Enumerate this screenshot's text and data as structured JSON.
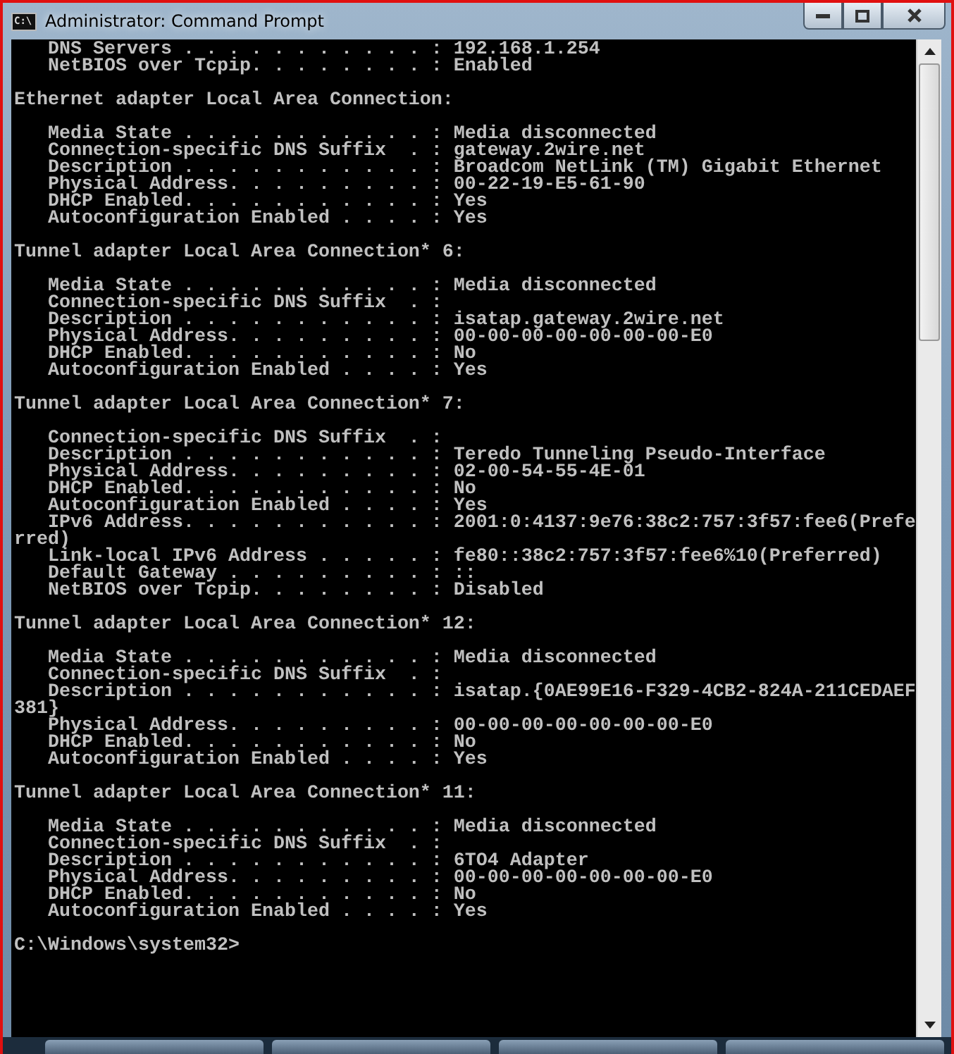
{
  "window": {
    "title": "Administrator: Command Prompt",
    "icon_text": "C:\\"
  },
  "console": {
    "blocks": [
      {
        "lines": [
          "   DNS Servers . . . . . . . . . . . : 192.168.1.254",
          "   NetBIOS over Tcpip. . . . . . . . : Enabled"
        ]
      },
      {
        "lines": [
          "Ethernet adapter Local Area Connection:"
        ]
      },
      {
        "lines": [
          "   Media State . . . . . . . . . . . : Media disconnected",
          "   Connection-specific DNS Suffix  . : gateway.2wire.net",
          "   Description . . . . . . . . . . . : Broadcom NetLink (TM) Gigabit Ethernet",
          "   Physical Address. . . . . . . . . : 00-22-19-E5-61-90",
          "   DHCP Enabled. . . . . . . . . . . : Yes",
          "   Autoconfiguration Enabled . . . . : Yes"
        ]
      },
      {
        "lines": [
          "Tunnel adapter Local Area Connection* 6:"
        ]
      },
      {
        "lines": [
          "   Media State . . . . . . . . . . . : Media disconnected",
          "   Connection-specific DNS Suffix  . :",
          "   Description . . . . . . . . . . . : isatap.gateway.2wire.net",
          "   Physical Address. . . . . . . . . : 00-00-00-00-00-00-00-E0",
          "   DHCP Enabled. . . . . . . . . . . : No",
          "   Autoconfiguration Enabled . . . . : Yes"
        ]
      },
      {
        "lines": [
          "Tunnel adapter Local Area Connection* 7:"
        ]
      },
      {
        "lines": [
          "   Connection-specific DNS Suffix  . :",
          "   Description . . . . . . . . . . . : Teredo Tunneling Pseudo-Interface",
          "   Physical Address. . . . . . . . . : 02-00-54-55-4E-01",
          "   DHCP Enabled. . . . . . . . . . . : No",
          "   Autoconfiguration Enabled . . . . : Yes",
          "   IPv6 Address. . . . . . . . . . . : 2001:0:4137:9e76:38c2:757:3f57:fee6(Prefe",
          "rred)",
          "   Link-local IPv6 Address . . . . . : fe80::38c2:757:3f57:fee6%10(Preferred)",
          "   Default Gateway . . . . . . . . . : ::",
          "   NetBIOS over Tcpip. . . . . . . . : Disabled"
        ]
      },
      {
        "lines": [
          "Tunnel adapter Local Area Connection* 12:"
        ]
      },
      {
        "lines": [
          "   Media State . . . . . . . . . . . : Media disconnected",
          "   Connection-specific DNS Suffix  . :",
          "   Description . . . . . . . . . . . : isatap.{0AE99E16-F329-4CB2-824A-211CEDAEF",
          "381}",
          "   Physical Address. . . . . . . . . : 00-00-00-00-00-00-00-E0",
          "   DHCP Enabled. . . . . . . . . . . : No",
          "   Autoconfiguration Enabled . . . . : Yes"
        ]
      },
      {
        "lines": [
          "Tunnel adapter Local Area Connection* 11:"
        ]
      },
      {
        "lines": [
          "   Media State . . . . . . . . . . . : Media disconnected",
          "   Connection-specific DNS Suffix  . :",
          "   Description . . . . . . . . . . . : 6TO4 Adapter",
          "   Physical Address. . . . . . . . . : 00-00-00-00-00-00-00-E0",
          "   DHCP Enabled. . . . . . . . . . . : No",
          "   Autoconfiguration Enabled . . . . : Yes"
        ]
      },
      {
        "lines": [
          "C:\\Windows\\system32>"
        ]
      }
    ]
  }
}
